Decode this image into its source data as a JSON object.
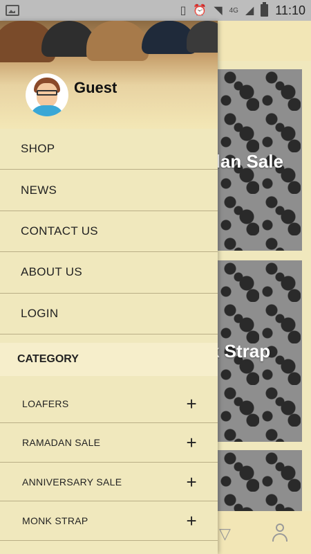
{
  "status_bar": {
    "time": "11:10",
    "network": "4G"
  },
  "drawer": {
    "user_name": "Guest",
    "menu": [
      {
        "label": "SHOP"
      },
      {
        "label": "NEWS"
      },
      {
        "label": "CONTACT US"
      },
      {
        "label": "ABOUT US"
      },
      {
        "label": "LOGIN"
      }
    ],
    "category_title": "CATEGORY",
    "categories": [
      {
        "label": "LOAFERS"
      },
      {
        "label": "RAMADAN SALE"
      },
      {
        "label": "ANNIVERSARY SALE"
      },
      {
        "label": "MONK STRAP"
      }
    ]
  },
  "background": {
    "banners": [
      {
        "title": "dan Sale"
      },
      {
        "title": "k Strap"
      }
    ]
  },
  "colors": {
    "drawer_bg": "#f0e8bd",
    "divider": "#b9ae86",
    "status_bar": "#bdbdbd"
  }
}
